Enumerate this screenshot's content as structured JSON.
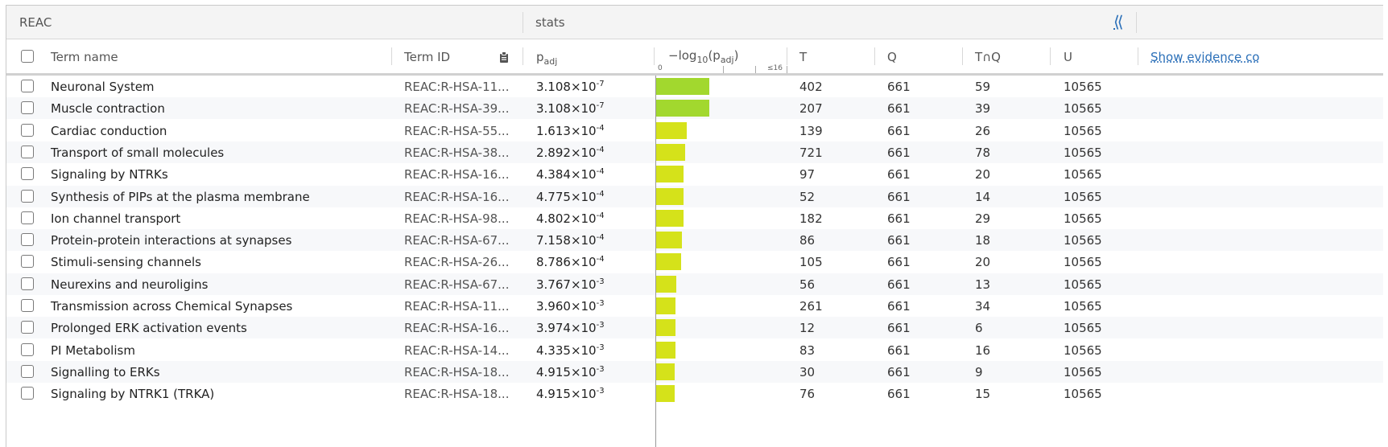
{
  "source": {
    "label": "REAC"
  },
  "stats": {
    "label": "stats",
    "collapse_icon": "double-chevron-left-icon"
  },
  "columns": {
    "term_name": "Term name",
    "term_id": "Term ID",
    "padj_base": "p",
    "padj_sub": "adj",
    "log_prefix": "−log",
    "log_base_sub": "10",
    "log_p": "(p",
    "log_p_sub": "adj",
    "log_close": ")",
    "tick_min": "0",
    "tick_max": "≤16",
    "t": "T",
    "q": "Q",
    "tq": "T∩Q",
    "u": "U",
    "show_evidence": "Show evidence co"
  },
  "colors": {
    "bar_high": "#a2d82e",
    "bar_low": "#d5e21a",
    "link": "#2a6fb8"
  },
  "rows": [
    {
      "name": "Neuronal System",
      "id": "REAC:R-HSA-11...",
      "p_mant": "3.108×10",
      "p_exp": "-7",
      "neglog10p": 6.51,
      "t": "402",
      "q": "661",
      "tq": "59",
      "u": "10565"
    },
    {
      "name": "Muscle contraction",
      "id": "REAC:R-HSA-39...",
      "p_mant": "3.108×10",
      "p_exp": "-7",
      "neglog10p": 6.51,
      "t": "207",
      "q": "661",
      "tq": "39",
      "u": "10565"
    },
    {
      "name": "Cardiac conduction",
      "id": "REAC:R-HSA-55...",
      "p_mant": "1.613×10",
      "p_exp": "-4",
      "neglog10p": 3.79,
      "t": "139",
      "q": "661",
      "tq": "26",
      "u": "10565"
    },
    {
      "name": "Transport of small molecules",
      "id": "REAC:R-HSA-38...",
      "p_mant": "2.892×10",
      "p_exp": "-4",
      "neglog10p": 3.54,
      "t": "721",
      "q": "661",
      "tq": "78",
      "u": "10565"
    },
    {
      "name": "Signaling by NTRKs",
      "id": "REAC:R-HSA-16...",
      "p_mant": "4.384×10",
      "p_exp": "-4",
      "neglog10p": 3.36,
      "t": "97",
      "q": "661",
      "tq": "20",
      "u": "10565"
    },
    {
      "name": "Synthesis of PIPs at the plasma membrane",
      "id": "REAC:R-HSA-16...",
      "p_mant": "4.775×10",
      "p_exp": "-4",
      "neglog10p": 3.32,
      "t": "52",
      "q": "661",
      "tq": "14",
      "u": "10565"
    },
    {
      "name": "Ion channel transport",
      "id": "REAC:R-HSA-98...",
      "p_mant": "4.802×10",
      "p_exp": "-4",
      "neglog10p": 3.32,
      "t": "182",
      "q": "661",
      "tq": "29",
      "u": "10565"
    },
    {
      "name": "Protein-protein interactions at synapses",
      "id": "REAC:R-HSA-67...",
      "p_mant": "7.158×10",
      "p_exp": "-4",
      "neglog10p": 3.15,
      "t": "86",
      "q": "661",
      "tq": "18",
      "u": "10565"
    },
    {
      "name": "Stimuli-sensing channels",
      "id": "REAC:R-HSA-26...",
      "p_mant": "8.786×10",
      "p_exp": "-4",
      "neglog10p": 3.06,
      "t": "105",
      "q": "661",
      "tq": "20",
      "u": "10565"
    },
    {
      "name": "Neurexins and neuroligins",
      "id": "REAC:R-HSA-67...",
      "p_mant": "3.767×10",
      "p_exp": "-3",
      "neglog10p": 2.42,
      "t": "56",
      "q": "661",
      "tq": "13",
      "u": "10565"
    },
    {
      "name": "Transmission across Chemical Synapses",
      "id": "REAC:R-HSA-11...",
      "p_mant": "3.960×10",
      "p_exp": "-3",
      "neglog10p": 2.4,
      "t": "261",
      "q": "661",
      "tq": "34",
      "u": "10565"
    },
    {
      "name": "Prolonged ERK activation events",
      "id": "REAC:R-HSA-16...",
      "p_mant": "3.974×10",
      "p_exp": "-3",
      "neglog10p": 2.4,
      "t": "12",
      "q": "661",
      "tq": "6",
      "u": "10565"
    },
    {
      "name": "PI Metabolism",
      "id": "REAC:R-HSA-14...",
      "p_mant": "4.335×10",
      "p_exp": "-3",
      "neglog10p": 2.36,
      "t": "83",
      "q": "661",
      "tq": "16",
      "u": "10565"
    },
    {
      "name": "Signalling to ERKs",
      "id": "REAC:R-HSA-18...",
      "p_mant": "4.915×10",
      "p_exp": "-3",
      "neglog10p": 2.31,
      "t": "30",
      "q": "661",
      "tq": "9",
      "u": "10565"
    },
    {
      "name": "Signaling by NTRK1 (TRKA)",
      "id": "REAC:R-HSA-18...",
      "p_mant": "4.915×10",
      "p_exp": "-3",
      "neglog10p": 2.31,
      "t": "76",
      "q": "661",
      "tq": "15",
      "u": "10565"
    }
  ]
}
